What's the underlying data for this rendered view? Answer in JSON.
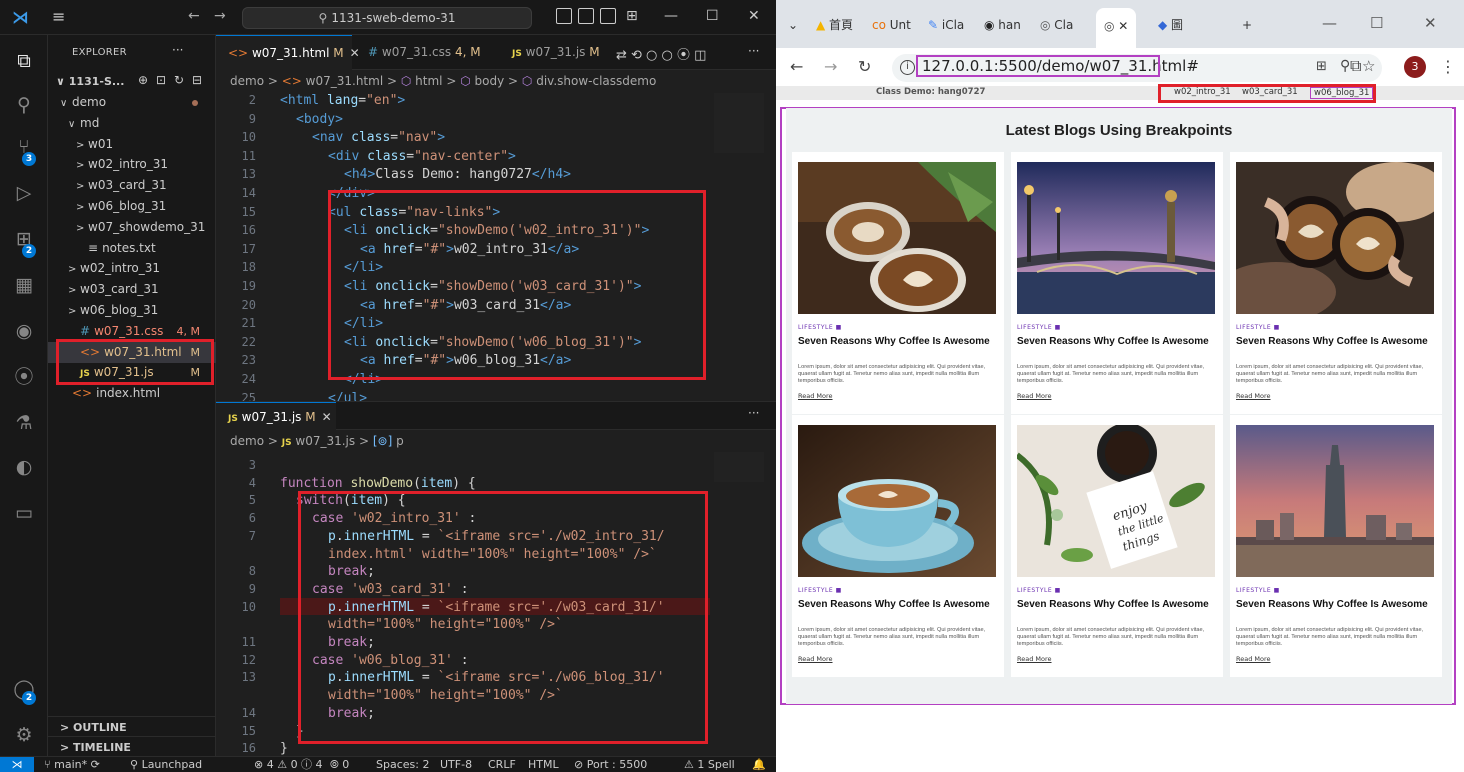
{
  "vscode": {
    "title_search": "1131-sweb-demo-31",
    "explorer_label": "EXPLORER",
    "project_name": "1131-S...",
    "tree": [
      {
        "label": "demo",
        "indent": 1,
        "chev": "∨",
        "kind": "folder-open",
        "dot": true
      },
      {
        "label": "md",
        "indent": 2,
        "chev": "∨",
        "kind": "folder-open"
      },
      {
        "label": "w01",
        "indent": 3,
        "chev": ">",
        "kind": "folder"
      },
      {
        "label": "w02_intro_31",
        "indent": 3,
        "chev": ">",
        "kind": "folder"
      },
      {
        "label": "w03_card_31",
        "indent": 3,
        "chev": ">",
        "kind": "folder"
      },
      {
        "label": "w06_blog_31",
        "indent": 3,
        "chev": ">",
        "kind": "folder"
      },
      {
        "label": "w07_showdemo_31",
        "indent": 3,
        "chev": ">",
        "kind": "folder"
      },
      {
        "label": "notes.txt",
        "indent": 3,
        "chev": "",
        "kind": "txt",
        "icon": "≡"
      },
      {
        "label": "w02_intro_31",
        "indent": 2,
        "chev": ">",
        "kind": "folder"
      },
      {
        "label": "w03_card_31",
        "indent": 2,
        "chev": ">",
        "kind": "folder"
      },
      {
        "label": "w06_blog_31",
        "indent": 2,
        "chev": ">",
        "kind": "folder"
      },
      {
        "label": "w07_31.css",
        "indent": 2,
        "chev": "",
        "kind": "css",
        "icon": "#",
        "status": "4, M"
      },
      {
        "label": "w07_31.html",
        "indent": 2,
        "chev": "",
        "kind": "html",
        "icon": "<>",
        "status": "M",
        "selected": true
      },
      {
        "label": "w07_31.js",
        "indent": 2,
        "chev": "",
        "kind": "js",
        "icon": "JS",
        "status": "M"
      },
      {
        "label": "index.html",
        "indent": 1,
        "chev": "",
        "kind": "html",
        "icon": "<>"
      }
    ],
    "outline_label": "OUTLINE",
    "timeline_label": "TIMELINE",
    "tabs": [
      {
        "icon": "<>",
        "label": "w07_31.html",
        "mod": "M",
        "close": "✕",
        "active": true
      },
      {
        "icon": "#",
        "label": "w07_31.css",
        "mod": "4, M"
      },
      {
        "icon": "JS",
        "label": "w07_31.js",
        "mod": "M"
      }
    ],
    "editor_more": "···",
    "breadcrumb1": [
      "demo",
      "w07_31.html",
      "html",
      "body",
      "div.show-classdemo"
    ],
    "html_lines": [
      {
        "n": "2",
        "segs": [
          [
            "tag",
            "<html "
          ],
          [
            "attr",
            "lang"
          ],
          [
            "plain",
            "="
          ],
          [
            "str",
            "\"en\""
          ],
          [
            "tag",
            ">"
          ]
        ],
        "indent": 0
      },
      {
        "n": "9",
        "segs": [
          [
            "tag",
            "<body>"
          ]
        ],
        "indent": 1
      },
      {
        "n": "10",
        "segs": [
          [
            "tag",
            "<nav "
          ],
          [
            "attr",
            "class"
          ],
          [
            "plain",
            "="
          ],
          [
            "str",
            "\"nav\""
          ],
          [
            "tag",
            ">"
          ]
        ],
        "indent": 2
      },
      {
        "n": "11",
        "segs": [
          [
            "tag",
            "<div "
          ],
          [
            "attr",
            "class"
          ],
          [
            "plain",
            "="
          ],
          [
            "str",
            "\"nav-center\""
          ],
          [
            "tag",
            ">"
          ]
        ],
        "indent": 3
      },
      {
        "n": "13",
        "segs": [
          [
            "tag",
            "<h4>"
          ],
          [
            "txt",
            "Class Demo: hang0727"
          ],
          [
            "tag",
            "</h4>"
          ]
        ],
        "indent": 4
      },
      {
        "n": "14",
        "segs": [
          [
            "tag",
            "</div>"
          ]
        ],
        "indent": 3
      },
      {
        "n": "15",
        "segs": [
          [
            "tag",
            "<ul "
          ],
          [
            "attr",
            "class"
          ],
          [
            "plain",
            "="
          ],
          [
            "str",
            "\"nav-links\""
          ],
          [
            "tag",
            ">"
          ]
        ],
        "indent": 3
      },
      {
        "n": "16",
        "segs": [
          [
            "tag",
            "<li "
          ],
          [
            "attr",
            "onclick"
          ],
          [
            "plain",
            "="
          ],
          [
            "str",
            "\"showDemo('w02_intro_31')\""
          ],
          [
            "tag",
            ">"
          ]
        ],
        "indent": 4
      },
      {
        "n": "17",
        "segs": [
          [
            "tag",
            "<a "
          ],
          [
            "attr",
            "href"
          ],
          [
            "plain",
            "="
          ],
          [
            "str",
            "\"#\""
          ],
          [
            "tag",
            ">"
          ],
          [
            "txt",
            "w02_intro_31"
          ],
          [
            "tag",
            "</a>"
          ]
        ],
        "indent": 5
      },
      {
        "n": "18",
        "segs": [
          [
            "tag",
            "</li>"
          ]
        ],
        "indent": 4
      },
      {
        "n": "19",
        "segs": [
          [
            "tag",
            "<li "
          ],
          [
            "attr",
            "onclick"
          ],
          [
            "plain",
            "="
          ],
          [
            "str",
            "\"showDemo('w03_card_31')\""
          ],
          [
            "tag",
            ">"
          ]
        ],
        "indent": 4
      },
      {
        "n": "20",
        "segs": [
          [
            "tag",
            "<a "
          ],
          [
            "attr",
            "href"
          ],
          [
            "plain",
            "="
          ],
          [
            "str",
            "\"#\""
          ],
          [
            "tag",
            ">"
          ],
          [
            "txt",
            "w03_card_31"
          ],
          [
            "tag",
            "</a>"
          ]
        ],
        "indent": 5
      },
      {
        "n": "21",
        "segs": [
          [
            "tag",
            "</li>"
          ]
        ],
        "indent": 4
      },
      {
        "n": "22",
        "segs": [
          [
            "tag",
            "<li "
          ],
          [
            "attr",
            "onclick"
          ],
          [
            "plain",
            "="
          ],
          [
            "str",
            "\"showDemo('w06_blog_31')\""
          ],
          [
            "tag",
            ">"
          ]
        ],
        "indent": 4
      },
      {
        "n": "23",
        "segs": [
          [
            "tag",
            "<a "
          ],
          [
            "attr",
            "href"
          ],
          [
            "plain",
            "="
          ],
          [
            "str",
            "\"#\""
          ],
          [
            "tag",
            ">"
          ],
          [
            "txt",
            "w06_blog_31"
          ],
          [
            "tag",
            "</a>"
          ]
        ],
        "indent": 5
      },
      {
        "n": "24",
        "segs": [
          [
            "tag",
            "</li>"
          ]
        ],
        "indent": 4
      },
      {
        "n": "25",
        "segs": [
          [
            "tag",
            "</ul>"
          ]
        ],
        "indent": 3
      }
    ],
    "tab2": {
      "icon": "JS",
      "label": "w07_31.js",
      "mod": "M",
      "close": "✕"
    },
    "breadcrumb2": [
      "demo",
      "w07_31.js",
      "p"
    ],
    "js_lines": [
      {
        "n": "3",
        "segs": [],
        "indent": 0
      },
      {
        "n": "4",
        "segs": [
          [
            "kw",
            "function "
          ],
          [
            "fn",
            "showDemo"
          ],
          [
            "plain",
            "("
          ],
          [
            "var",
            "item"
          ],
          [
            "plain",
            ") {"
          ]
        ],
        "indent": 0
      },
      {
        "n": "5",
        "segs": [
          [
            "kw",
            "switch"
          ],
          [
            "plain",
            "("
          ],
          [
            "var",
            "item"
          ],
          [
            "plain",
            ") {"
          ]
        ],
        "indent": 1
      },
      {
        "n": "6",
        "segs": [
          [
            "kw",
            "case "
          ],
          [
            "str",
            "'w02_intro_31'"
          ],
          [
            "plain",
            " :"
          ]
        ],
        "indent": 2
      },
      {
        "n": "7",
        "segs": [
          [
            "var",
            "p"
          ],
          [
            "plain",
            "."
          ],
          [
            "var",
            "innerHTML"
          ],
          [
            "plain",
            " = "
          ],
          [
            "tmpl",
            "`<iframe src='./w02_intro_31/"
          ]
        ],
        "indent": 3
      },
      {
        "n": "",
        "segs": [
          [
            "tmpl",
            "index.html' width=\"100%\" height=\"100%\" />`"
          ]
        ],
        "indent": 3
      },
      {
        "n": "8",
        "segs": [
          [
            "kw",
            "break"
          ],
          [
            "plain",
            ";"
          ]
        ],
        "indent": 3
      },
      {
        "n": "9",
        "segs": [
          [
            "kw",
            "case "
          ],
          [
            "str",
            "'w03_card_31'"
          ],
          [
            "plain",
            " :"
          ]
        ],
        "indent": 2
      },
      {
        "n": "10",
        "segs": [
          [
            "var",
            "p"
          ],
          [
            "plain",
            "."
          ],
          [
            "var",
            "innerHTML"
          ],
          [
            "plain",
            " = "
          ],
          [
            "tmpl",
            "`<iframe src='./w03_card_31/'"
          ]
        ],
        "indent": 3,
        "err": true
      },
      {
        "n": "",
        "segs": [
          [
            "tmpl",
            "width=\"100%\" height=\"100%\" />`"
          ]
        ],
        "indent": 3
      },
      {
        "n": "11",
        "segs": [
          [
            "kw",
            "break"
          ],
          [
            "plain",
            ";"
          ]
        ],
        "indent": 3
      },
      {
        "n": "12",
        "segs": [
          [
            "kw",
            "case "
          ],
          [
            "str",
            "'w06_blog_31'"
          ],
          [
            "plain",
            " :"
          ]
        ],
        "indent": 2
      },
      {
        "n": "13",
        "segs": [
          [
            "var",
            "p"
          ],
          [
            "plain",
            "."
          ],
          [
            "var",
            "innerHTML"
          ],
          [
            "plain",
            " = "
          ],
          [
            "tmpl",
            "`<iframe src='./w06_blog_31/'"
          ]
        ],
        "indent": 3
      },
      {
        "n": "",
        "segs": [
          [
            "tmpl",
            "width=\"100%\" height=\"100%\" />`"
          ]
        ],
        "indent": 3
      },
      {
        "n": "14",
        "segs": [
          [
            "kw",
            "break"
          ],
          [
            "plain",
            ";"
          ]
        ],
        "indent": 3
      },
      {
        "n": "15",
        "segs": [
          [
            "plain",
            "}"
          ]
        ],
        "indent": 1
      },
      {
        "n": "16",
        "segs": [
          [
            "plain",
            "}"
          ]
        ],
        "indent": 0
      }
    ],
    "status": {
      "branch": "main*",
      "launch": "Launchpad",
      "problems": "⊗ 4 ⚠ 0 ⓘ 4",
      "ports": "0",
      "spaces": "Spaces: 2",
      "encoding": "UTF-8",
      "eol": "CRLF",
      "lang": "HTML",
      "port": "Port : 5500",
      "spell": "⚠ 1 Spell"
    }
  },
  "browser": {
    "tabs": [
      {
        "icon": "▲",
        "label": "首頁"
      },
      {
        "icon": "co",
        "label": "Unt"
      },
      {
        "icon": "✎",
        "label": "iCla"
      },
      {
        "icon": "◉",
        "label": "han"
      },
      {
        "icon": "◎",
        "label": "Cla"
      },
      {
        "icon": "◎",
        "label": "",
        "active": true,
        "close": "✕"
      },
      {
        "icon": "◆",
        "label": "圖"
      }
    ],
    "new_tab": "+",
    "url": "127.0.0.1:5500/demo/w07_31.html#",
    "avatar": "3",
    "page": {
      "brand": "Class Demo: hang0727",
      "links": [
        "w02_intro_31",
        "w03_card_31",
        "w06_blog_31"
      ],
      "title": "Latest Blogs Using Breakpoints",
      "cards": [
        {
          "cat": "LIFESTYLE",
          "title": "Seven Reasons Why Coffee Is Awesome",
          "body": "Lorem ipsum, dolor sit amet consectetur adipisicing elit. Qui provident vitae, quaerat ullam fugit at. Tenetur nemo alias sunt, impedit nulla mollitia illum temporibus officiis.",
          "more": "Read More",
          "scene": "latte"
        },
        {
          "cat": "LIFESTYLE",
          "title": "Seven Reasons Why Coffee Is Awesome",
          "body": "Lorem ipsum, dolor sit amet consectetur adipisicing elit. Qui provident vitae, quaerat ullam fugit at. Tenetur nemo alias sunt, impedit nulla mollitia illum temporibus officiis.",
          "more": "Read More",
          "scene": "bridge"
        },
        {
          "cat": "LIFESTYLE",
          "title": "Seven Reasons Why Coffee Is Awesome",
          "body": "Lorem ipsum, dolor sit amet consectetur adipisicing elit. Qui provident vitae, quaerat ullam fugit at. Tenetur nemo alias sunt, impedit nulla mollitia illum temporibus officiis.",
          "more": "Read More",
          "scene": "cheers"
        },
        {
          "cat": "LIFESTYLE",
          "title": "Seven Reasons Why Coffee Is Awesome",
          "body": "Lorem ipsum, dolor sit amet consectetur adipisicing elit. Qui provident vitae, quaerat ullam fugit at. Tenetur nemo alias sunt, impedit nulla mollitia illum temporibus officiis.",
          "more": "Read More",
          "scene": "cup"
        },
        {
          "cat": "LIFESTYLE",
          "title": "Seven Reasons Why Coffee Is Awesome",
          "body": "Lorem ipsum, dolor sit amet consectetur adipisicing elit. Qui provident vitae, quaerat ullam fugit at. Tenetur nemo alias sunt, impedit nulla mollitia illum temporibus officiis.",
          "more": "Read More",
          "scene": "note"
        },
        {
          "cat": "LIFESTYLE",
          "title": "Seven Reasons Why Coffee Is Awesome",
          "body": "Lorem ipsum, dolor sit amet consectetur adipisicing elit. Qui provident vitae, quaerat ullam fugit at. Tenetur nemo alias sunt, impedit nulla mollitia illum temporibus officiis.",
          "more": "Read More",
          "scene": "city"
        }
      ]
    }
  },
  "colors": {
    "accent": "#0078d4",
    "highlight_red": "#e0202a",
    "highlight_purple": "#b340c2",
    "category": "#6a2fb0"
  }
}
